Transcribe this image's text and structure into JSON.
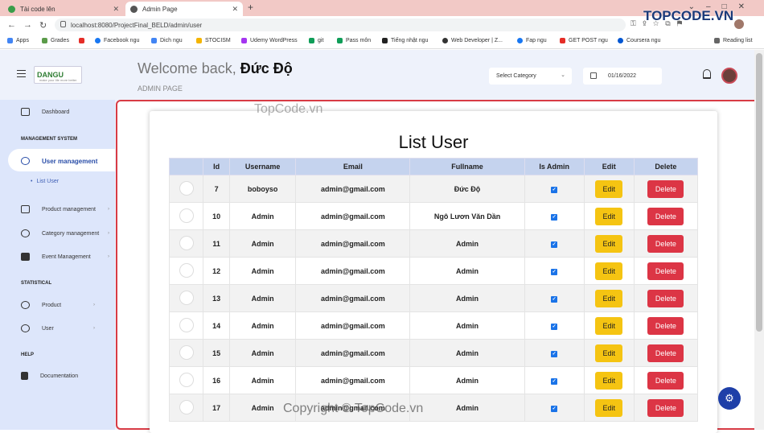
{
  "browser": {
    "tabs": [
      {
        "title": "Tài code lên",
        "active": false
      },
      {
        "title": "Admin Page",
        "active": true
      }
    ],
    "url": "localhost:8080/ProjectFinal_BELD/admin/user",
    "bookmarks": [
      "Apps",
      "Grades",
      "Facebook ngu",
      "Dich ngu",
      "STOCISM",
      "Udemy WordPress",
      "git",
      "Pass môn",
      "Tiếng nhật ngu",
      "Web Developer | Z...",
      "Fap ngu",
      "GET POST ngu",
      "Coursera ngu",
      "Reading list"
    ]
  },
  "header": {
    "logo": "DANGU",
    "logo_tagline": "make your life more better",
    "welcome_prefix": "Welcome back,",
    "user_name": "Đức Độ",
    "subtitle": "ADMIN PAGE",
    "category_select": "Select Category",
    "date": "01/16/2022"
  },
  "sidebar": {
    "dashboard": "Dashboard",
    "sections": [
      {
        "heading": "MANAGEMENT SYSTEM"
      },
      {
        "heading": "STATISTICAL"
      },
      {
        "heading": "HELP"
      }
    ],
    "items": {
      "user_management": "User management",
      "list_user": "List User",
      "product_management": "Product management",
      "category_management": "Category management",
      "event_management": "Event Management",
      "product": "Product",
      "user": "User",
      "documentation": "Documentation"
    }
  },
  "main": {
    "title": "List User",
    "columns": [
      "",
      "Id",
      "Username",
      "Email",
      "Fullname",
      "Is Admin",
      "Edit",
      "Delete"
    ],
    "edit_label": "Edit",
    "delete_label": "Delete",
    "rows": [
      {
        "id": "7",
        "username": "boboyso",
        "email": "admin@gmail.com",
        "fullname": "Đức Độ",
        "is_admin": true
      },
      {
        "id": "10",
        "username": "Admin",
        "email": "admin@gmail.com",
        "fullname": "Ngô Lươn Văn Dần",
        "is_admin": true
      },
      {
        "id": "11",
        "username": "Admin",
        "email": "admin@gmail.com",
        "fullname": "Admin",
        "is_admin": true
      },
      {
        "id": "12",
        "username": "Admin",
        "email": "admin@gmail.com",
        "fullname": "Admin",
        "is_admin": true
      },
      {
        "id": "13",
        "username": "Admin",
        "email": "admin@gmail.com",
        "fullname": "Admin",
        "is_admin": true
      },
      {
        "id": "14",
        "username": "Admin",
        "email": "admin@gmail.com",
        "fullname": "Admin",
        "is_admin": true
      },
      {
        "id": "15",
        "username": "Admin",
        "email": "admin@gmail.com",
        "fullname": "Admin",
        "is_admin": true
      },
      {
        "id": "16",
        "username": "Admin",
        "email": "admin@gmail.com",
        "fullname": "Admin",
        "is_admin": true
      },
      {
        "id": "17",
        "username": "Admin",
        "email": "admin@gmail.com",
        "fullname": "Admin",
        "is_admin": true
      }
    ]
  },
  "watermarks": {
    "logo": "TOPCODE.VN",
    "center": "TopCode.vn",
    "bottom": "Copyright © TopCode.vn"
  },
  "colors": {
    "accent": "#1e3fa8",
    "danger": "#dc3545",
    "warning": "#f5c412",
    "border": "#d83b45"
  }
}
